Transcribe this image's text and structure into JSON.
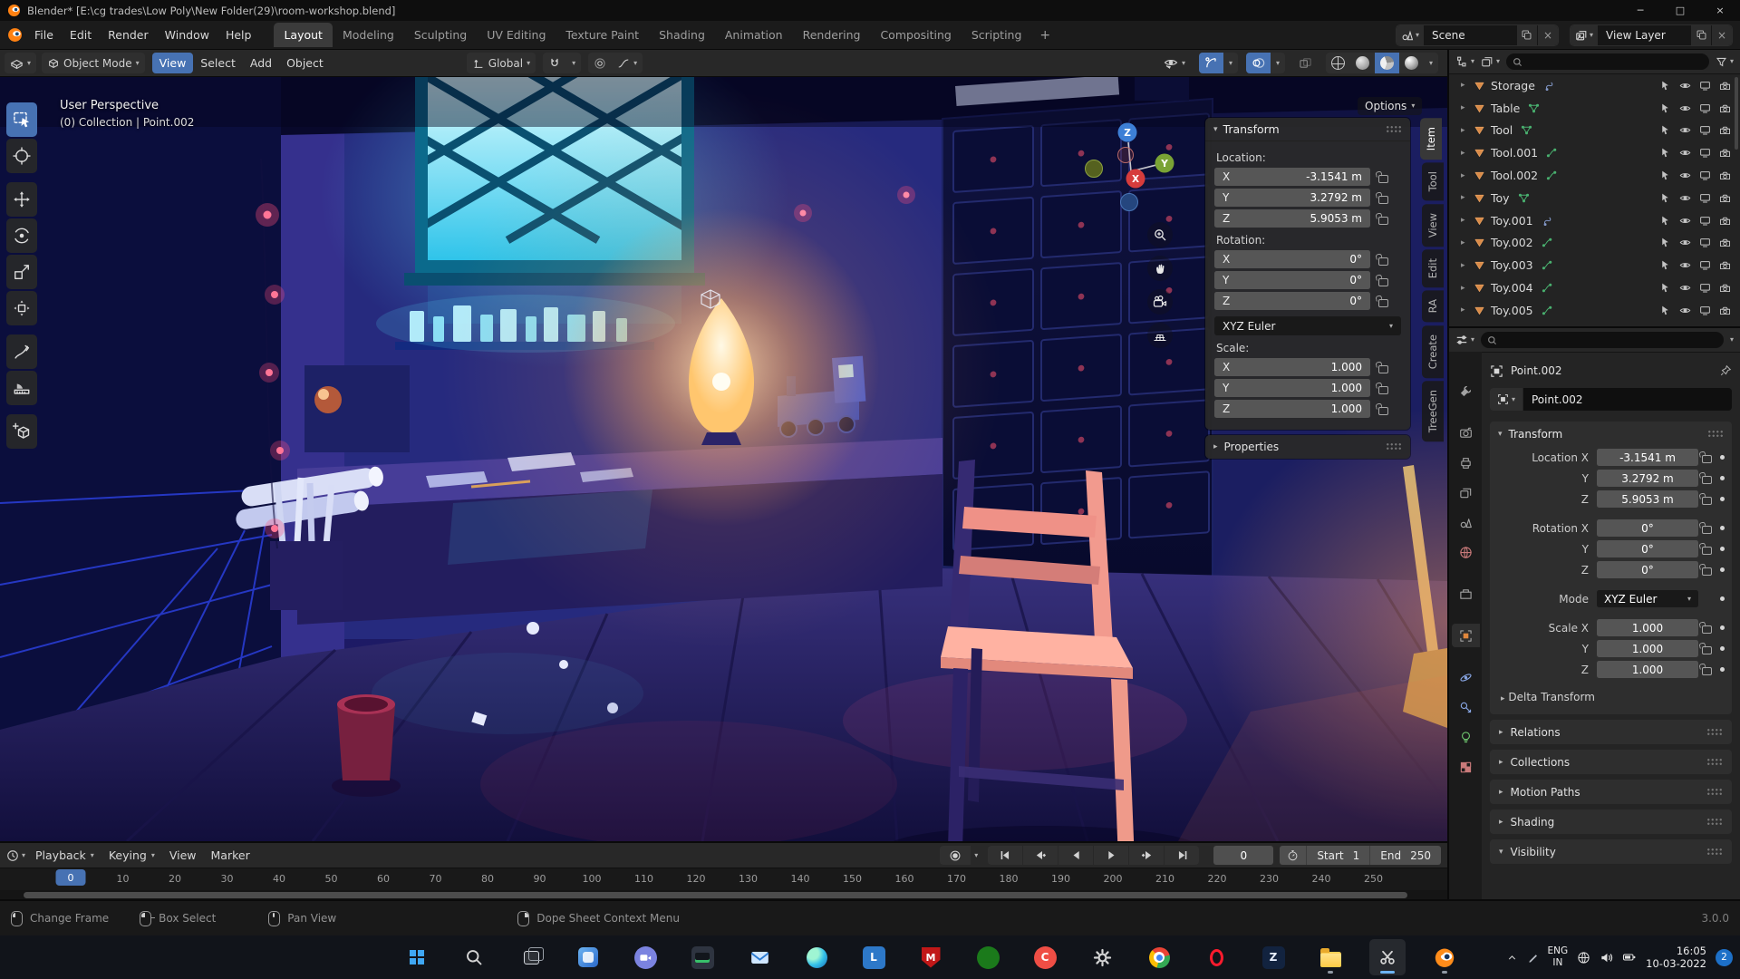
{
  "window": {
    "title": "Blender* [E:\\cg trades\\Low Poly\\New Folder(29)\\room-workshop.blend]",
    "controls": {
      "minimize": "─",
      "maximize": "□",
      "close": "×"
    }
  },
  "theme": {
    "accent_blue": "#4772b3",
    "object_orange": "#e0873c",
    "axis_x": "#d63c3c",
    "axis_y": "#7aa335",
    "axis_z": "#3d7fd6"
  },
  "topbar": {
    "menus": [
      "File",
      "Edit",
      "Render",
      "Window",
      "Help"
    ],
    "workspaces": [
      "Layout",
      "Modeling",
      "Sculpting",
      "UV Editing",
      "Texture Paint",
      "Shading",
      "Animation",
      "Rendering",
      "Compositing",
      "Scripting"
    ],
    "active_workspace": "Layout",
    "add_workspace_label": "+",
    "scene_name": "Scene",
    "view_layer_name": "View Layer"
  },
  "viewport_header": {
    "mode": "Object Mode",
    "menus": [
      {
        "label": "View",
        "highlighted": true
      },
      {
        "label": "Select"
      },
      {
        "label": "Add"
      },
      {
        "label": "Object"
      }
    ],
    "orientation": "Global"
  },
  "toolbar": {
    "active_tool": "select-box",
    "tools": [
      "select-box",
      "cursor",
      "move",
      "rotate",
      "scale",
      "transform",
      "annotate",
      "measure",
      "add-cube"
    ]
  },
  "viewport": {
    "view_label": "User Perspective",
    "collection_label": "(0) Collection | Point.002",
    "options_label": "Options",
    "gizmo": {
      "x": "X",
      "y": "Y",
      "z": "Z"
    }
  },
  "sidebar": {
    "active_tab": "Item",
    "tabs": [
      "Item",
      "Tool",
      "View",
      "Edit",
      "RA",
      "Create",
      "TreeGen"
    ]
  },
  "transform_panel": {
    "title": "Transform",
    "location": {
      "label": "Location:",
      "rows": [
        {
          "axis": "X",
          "value": "-3.1541 m"
        },
        {
          "axis": "Y",
          "value": "3.2792 m"
        },
        {
          "axis": "Z",
          "value": "5.9053 m"
        }
      ]
    },
    "rotation": {
      "label": "Rotation:",
      "rows": [
        {
          "axis": "X",
          "value": "0°"
        },
        {
          "axis": "Y",
          "value": "0°"
        },
        {
          "axis": "Z",
          "value": "0°"
        }
      ]
    },
    "rotation_mode": "XYZ Euler",
    "scale": {
      "label": "Scale:",
      "rows": [
        {
          "axis": "X",
          "value": "1.000"
        },
        {
          "axis": "Y",
          "value": "1.000"
        },
        {
          "axis": "Z",
          "value": "1.000"
        }
      ]
    },
    "properties_section": "Properties"
  },
  "outliner": {
    "items": [
      {
        "name": "Storage",
        "data": "hook"
      },
      {
        "name": "Table",
        "data": "mesh"
      },
      {
        "name": "Tool",
        "data": "mesh"
      },
      {
        "name": "Tool.001",
        "data": "curve"
      },
      {
        "name": "Tool.002",
        "data": "curve"
      },
      {
        "name": "Toy",
        "data": "mesh"
      },
      {
        "name": "Toy.001",
        "data": "hook"
      },
      {
        "name": "Toy.002",
        "data": "curve"
      },
      {
        "name": "Toy.003",
        "data": "curve"
      },
      {
        "name": "Toy.004",
        "data": "curve"
      },
      {
        "name": "Toy.005",
        "data": "curve"
      }
    ]
  },
  "properties": {
    "breadcrumb": "Point.002",
    "object_name": "Point.002",
    "tabs": [
      "tool",
      "render",
      "output",
      "view-layer",
      "scene",
      "world",
      "collection",
      "object",
      "physics",
      "constraints",
      "data",
      "texture"
    ],
    "active_tab": "object",
    "transform": {
      "title": "Transform",
      "rows": [
        {
          "label": "Location X",
          "value": "-3.1541 m"
        },
        {
          "label": "Y",
          "value": "3.2792 m"
        },
        {
          "label": "Z",
          "value": "5.9053 m"
        },
        {
          "label": "Rotation X",
          "value": "0°"
        },
        {
          "label": "Y",
          "value": "0°"
        },
        {
          "label": "Z",
          "value": "0°"
        },
        {
          "label": "Mode",
          "value": "XYZ Euler",
          "dropdown": true
        },
        {
          "label": "Scale X",
          "value": "1.000"
        },
        {
          "label": "Y",
          "value": "1.000"
        },
        {
          "label": "Z",
          "value": "1.000"
        }
      ],
      "delta_label": "Delta Transform"
    },
    "sections": [
      {
        "label": "Relations"
      },
      {
        "label": "Collections"
      },
      {
        "label": "Motion Paths"
      },
      {
        "label": "Shading"
      },
      {
        "label": "Visibility",
        "expanded": true
      }
    ]
  },
  "timeline": {
    "menus": [
      {
        "label": "Playback",
        "dropdown": true
      },
      {
        "label": "Keying",
        "dropdown": true
      },
      {
        "label": "View"
      },
      {
        "label": "Marker"
      }
    ],
    "current_frame": "0",
    "start_label": "Start",
    "start_value": "1",
    "end_label": "End",
    "end_value": "250",
    "ticks": [
      0,
      10,
      20,
      30,
      40,
      50,
      60,
      70,
      80,
      90,
      100,
      110,
      120,
      130,
      140,
      150,
      160,
      170,
      180,
      190,
      200,
      210,
      220,
      230,
      240,
      250
    ]
  },
  "status_bar": {
    "hints": [
      {
        "button": "left",
        "label": "Change Frame"
      },
      {
        "button": "left-drag",
        "label": "Box Select"
      },
      {
        "button": "middle",
        "label": "Pan View"
      },
      {
        "button": "right",
        "label": "Dope Sheet Context Menu"
      }
    ],
    "version": "3.0.0"
  },
  "taskbar": {
    "apps": [
      {
        "id": "start"
      },
      {
        "id": "search"
      },
      {
        "id": "task-view"
      },
      {
        "id": "widgets"
      },
      {
        "id": "teams"
      },
      {
        "id": "task-manager"
      },
      {
        "id": "mail"
      },
      {
        "id": "edge"
      },
      {
        "id": "lightshot"
      },
      {
        "id": "mcafee"
      },
      {
        "id": "xbox"
      },
      {
        "id": "clipchamp"
      },
      {
        "id": "settings"
      },
      {
        "id": "chrome"
      },
      {
        "id": "opera"
      },
      {
        "id": "app-z"
      },
      {
        "id": "file-explorer",
        "running": true
      },
      {
        "id": "snipping-tool",
        "running": true,
        "active": true
      },
      {
        "id": "blender",
        "running": true
      }
    ],
    "tray": {
      "language_primary": "ENG",
      "language_secondary": "IN",
      "time": "16:05",
      "date": "10-03-2022",
      "notification_count": "2"
    }
  }
}
